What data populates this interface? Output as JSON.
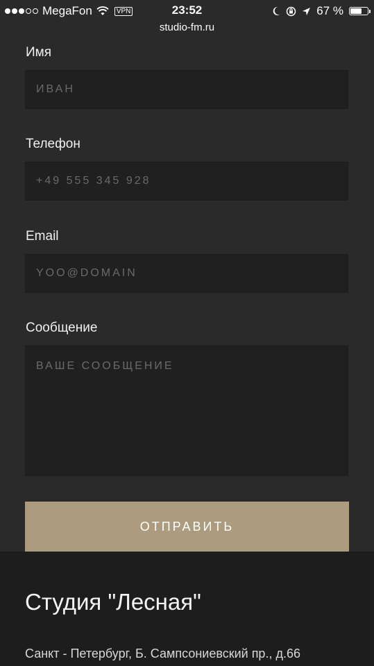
{
  "status_bar": {
    "carrier": "MegaFon",
    "vpn": "VPN",
    "time": "23:52",
    "battery": "67 %",
    "battery_level": 0.67
  },
  "browser": {
    "url": "studio-fm.ru"
  },
  "form": {
    "name": {
      "label": "Имя",
      "placeholder": "ИВАН"
    },
    "phone": {
      "label": "Телефон",
      "placeholder": "+49 555 345 928"
    },
    "email": {
      "label": "Email",
      "placeholder": "YOO@DOMAIN"
    },
    "message": {
      "label": "Сообщение",
      "placeholder": "ВАШЕ СООБЩЕНИЕ"
    },
    "submit_label": "ОТПРАВИТЬ"
  },
  "footer": {
    "title": "Студия \"Лесная\"",
    "address": "Санкт - Петербург, Б. Сампсониевский пр., д.66"
  },
  "colors": {
    "background": "#2a2a2a",
    "field": "#202020",
    "accent": "#ad9b80",
    "footer": "#1d1d1d"
  }
}
